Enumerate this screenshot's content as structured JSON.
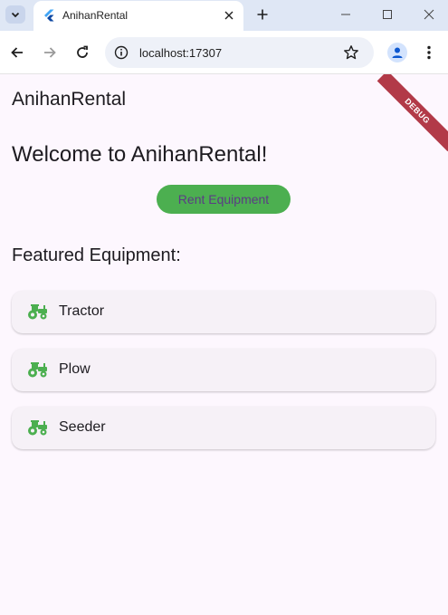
{
  "browser": {
    "tab_title": "AnihanRental",
    "url": "localhost:17307"
  },
  "app": {
    "title": "AnihanRental",
    "debug_banner": "DEBUG",
    "welcome": "Welcome to AnihanRental!",
    "rent_button": "Rent Equipment",
    "featured_title": "Featured Equipment:",
    "equipment": [
      {
        "label": "Tractor",
        "icon": "tractor-icon"
      },
      {
        "label": "Plow",
        "icon": "tractor-icon"
      },
      {
        "label": "Seeder",
        "icon": "tractor-icon"
      }
    ]
  },
  "colors": {
    "accent_green": "#4caf50",
    "button_text": "#5b3c85",
    "background": "#fdf7fe",
    "card": "#f6f1f7",
    "debug": "#b23a48"
  }
}
